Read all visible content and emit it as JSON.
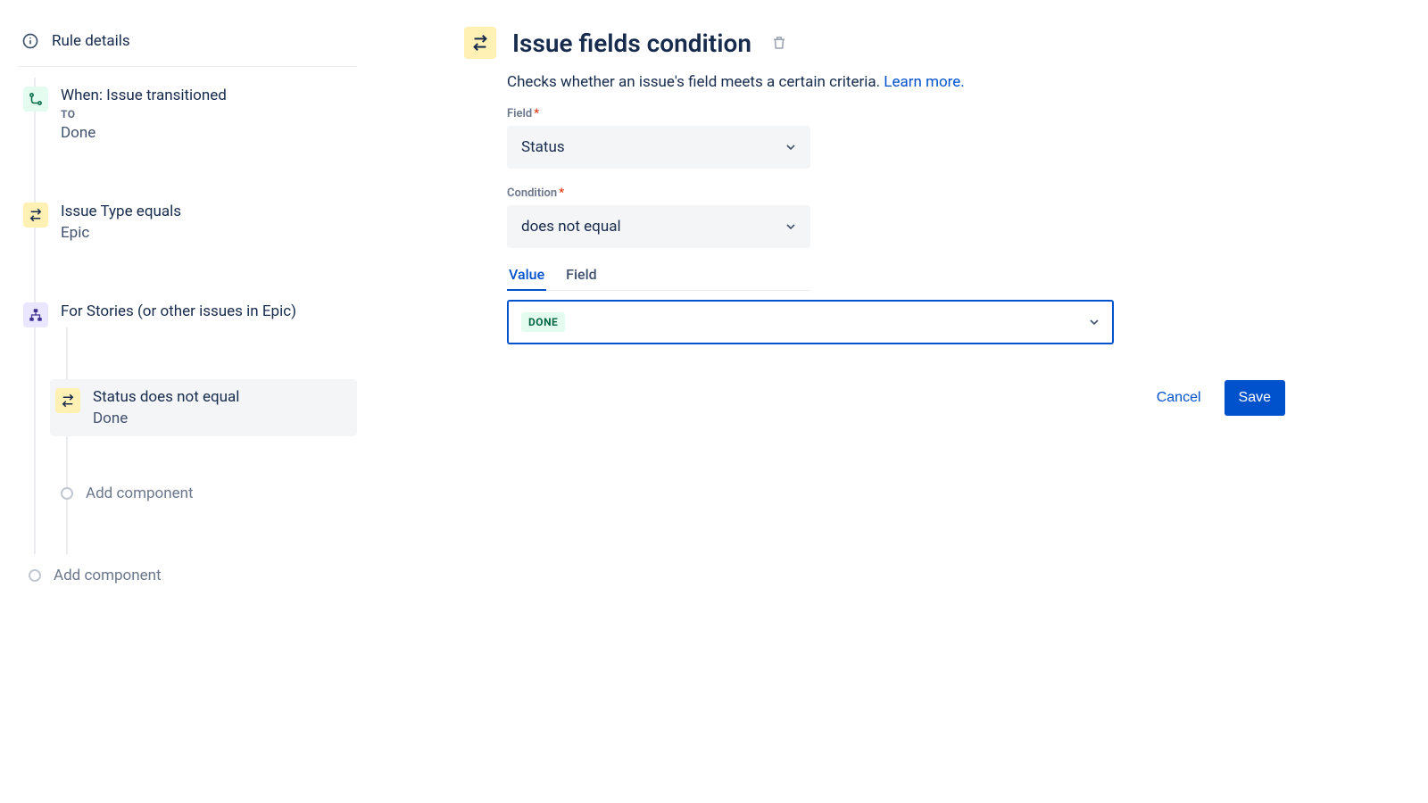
{
  "sidebar": {
    "ruleDetails": "Rule details",
    "steps": [
      {
        "title": "When: Issue transitioned",
        "sublabel": "TO",
        "sub": "Done"
      },
      {
        "title": "Issue Type equals",
        "sub": "Epic"
      },
      {
        "title": "For Stories (or other issues in Epic)"
      },
      {
        "title": "Status does not equal",
        "sub": "Done"
      }
    ],
    "addComponent": "Add component"
  },
  "main": {
    "title": "Issue fields condition",
    "description": "Checks whether an issue's field meets a certain criteria. ",
    "learnMore": "Learn more.",
    "fields": {
      "fieldLabel": "Field",
      "fieldValue": "Status",
      "conditionLabel": "Condition",
      "conditionValue": "does not equal",
      "tabs": {
        "value": "Value",
        "field": "Field"
      },
      "valueChip": "DONE"
    },
    "actions": {
      "cancel": "Cancel",
      "save": "Save"
    }
  }
}
